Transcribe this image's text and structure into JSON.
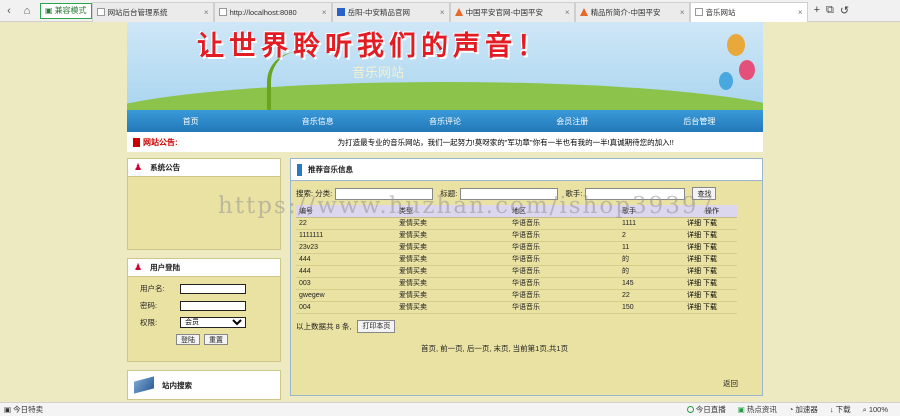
{
  "browser": {
    "mode_label": "兼容模式",
    "tabs": [
      {
        "label": "网站后台管理系统",
        "icon": "page-icon",
        "active": false
      },
      {
        "label": "http://localhost:8080",
        "icon": "page-icon",
        "active": false
      },
      {
        "label": "岳阳-中安精品官网",
        "icon": "lu-icon",
        "active": false
      },
      {
        "label": "中国平安官网-中国平安",
        "icon": "pingan-icon",
        "active": false
      },
      {
        "label": "精品所简介-中国平安",
        "icon": "pingan-icon",
        "active": false
      },
      {
        "label": "音乐网站",
        "icon": "page-icon",
        "active": true
      }
    ],
    "status": {
      "left": "今日特卖",
      "right": [
        "今日直播",
        "热点资讯",
        "加速器",
        "下载"
      ],
      "zoom": "100%"
    }
  },
  "site": {
    "slogan": "让世界聆听我们的声音！",
    "subtitle": "音乐网站",
    "nav": [
      "首页",
      "音乐信息",
      "音乐评论",
      "会员注册",
      "后台管理"
    ],
    "announce_label": "网站公告:",
    "announce_text": "为打造最专业的音乐网站，我们一起努力!莫呀家的\"军功章\"你有一半也有我的一半!真诚期待您的加入!!"
  },
  "sidebar": {
    "notice_title": "系统公告",
    "login_title": "用户登陆",
    "login": {
      "username_label": "用户名:",
      "password_label": "密码:",
      "role_label": "权限:",
      "role_value": "会员",
      "login_button": "登陆",
      "reset_button": "重置"
    },
    "search_title": "站内搜索"
  },
  "main": {
    "title": "推荐音乐信息",
    "search": {
      "genre_label": "搜索: 分类:",
      "title_label": "标题:",
      "singer_label": "歌手:",
      "search_button": "查找"
    },
    "columns": [
      "编号",
      "类型",
      "地区",
      "歌手",
      "操作"
    ],
    "rows": [
      {
        "id": "22",
        "type": "爱情买卖",
        "region": "华语音乐",
        "singer": "1111",
        "ops": "详细  下载"
      },
      {
        "id": "1111111",
        "type": "爱情买卖",
        "region": "华语音乐",
        "singer": "2",
        "ops": "详细  下载"
      },
      {
        "id": "23v23",
        "type": "爱情买卖",
        "region": "华语音乐",
        "singer": "11",
        "ops": "详细  下载"
      },
      {
        "id": "444",
        "type": "爱情买卖",
        "region": "华语音乐",
        "singer": "的",
        "ops": "详细  下载"
      },
      {
        "id": "444",
        "type": "爱情买卖",
        "region": "华语音乐",
        "singer": "的",
        "ops": "详细  下载"
      },
      {
        "id": "003",
        "type": "爱情买卖",
        "region": "华语音乐",
        "singer": "145",
        "ops": "详细  下载"
      },
      {
        "id": "gwegew",
        "type": "爱情买卖",
        "region": "华语音乐",
        "singer": "22",
        "ops": "详细  下载"
      },
      {
        "id": "004",
        "type": "爱情买卖",
        "region": "华语音乐",
        "singer": "150",
        "ops": "详细  下载"
      }
    ],
    "total_text": "以上数据共 8 条,",
    "print_button": "打印本页",
    "pager": "首页, 前一页, 后一页, 末页, 当前第1页,共1页",
    "back_link": "返回"
  },
  "watermark": "https://www.huzhan.com/ishop39397"
}
